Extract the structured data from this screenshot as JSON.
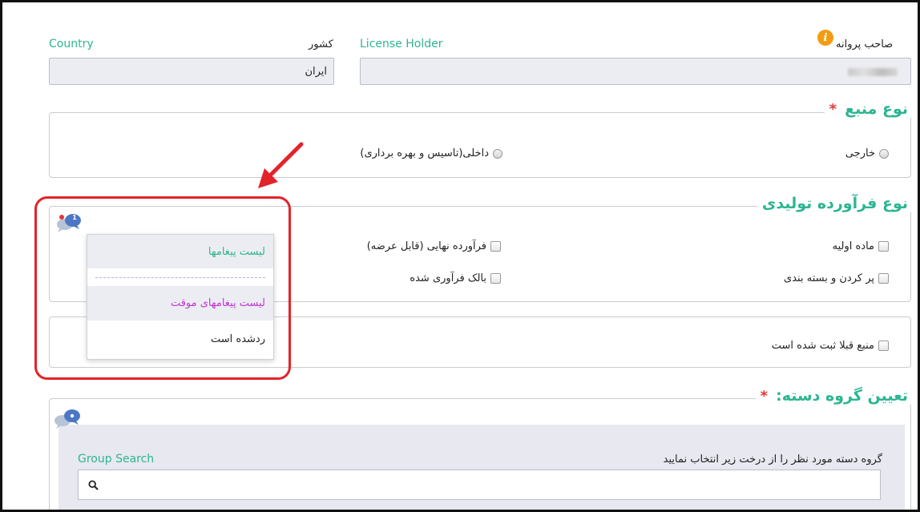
{
  "header": {
    "country_label_en": "Country",
    "country_label_fa": "کشور",
    "country_value": "ایران",
    "license_holder_label_en": "License Holder",
    "license_holder_label_fa": "صاحب پروانه",
    "info_icon_glyph": "i"
  },
  "resource_type": {
    "legend": "نوع منبع",
    "required_mark": "*",
    "options": [
      "خارجی",
      "داخلی(تاسیس و بهره برداری)"
    ]
  },
  "product_type": {
    "legend": "نوع فرآورده تولیدی",
    "options": [
      "ماده اولیه",
      "فرآورده نهایی (قابل عرضه)",
      "پر کردن و بسته بندی",
      "بالک فرآوری شده"
    ]
  },
  "registered": {
    "label": "منبع قبلا ثبت شده است"
  },
  "group": {
    "legend": "تعیین گروه دسته:",
    "required_mark": "*",
    "instruction": "گروه دسته مورد نظر را از درخت زیر انتخاب نمایید",
    "search_label": "Group Search",
    "search_value": ""
  },
  "message_menu": {
    "badge": "1",
    "items": [
      "لیست پیغامها",
      "لیست پیغامهای موقت",
      "ردشده است"
    ]
  },
  "colors": {
    "accent_green": "#2db592",
    "required_red": "#e5363a",
    "highlight_red": "#e3232a",
    "temp_list_purple": "#c334d6",
    "info_orange": "#f39c12"
  }
}
